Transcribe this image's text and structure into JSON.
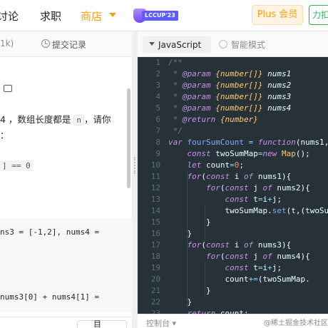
{
  "nav": {
    "item_discuss": "讨论",
    "item_jobs": "求职",
    "item_store": "商店",
    "badge": "LCCUP'23",
    "plus": "Plus 会员",
    "force": "力扣"
  },
  "problem": {
    "tab_k": "1k)",
    "tab_submissions": "提交记录",
    "desc_line1_a": "4 ，数组长度都是 ",
    "desc_chip": "n",
    "desc_line1_b": "，请你",
    "desc_line2": "：",
    "condition": "] == 0",
    "example_line1": "ns3 = [-1,2], nums4 =",
    "example_line2": "",
    "example_line3": " nums3[0] + nums4[1] =",
    "bottom_btn": "目"
  },
  "editor": {
    "language": "JavaScript",
    "smart_mode": "智能模式",
    "lines": [
      {
        "n": "1",
        "t": "/**"
      },
      {
        "n": "2",
        "t": " * @param {number[]} nums1"
      },
      {
        "n": "3",
        "t": " * @param {number[]} nums2"
      },
      {
        "n": "4",
        "t": " * @param {number[]} nums3"
      },
      {
        "n": "5",
        "t": " * @param {number[]} nums4"
      },
      {
        "n": "6",
        "t": " * @return {number}"
      },
      {
        "n": "7",
        "t": " */"
      },
      {
        "n": "8",
        "t": "var fourSumCount = function(nums1,"
      },
      {
        "n": "9",
        "t": "    const twoSumMap=new Map();"
      },
      {
        "n": "10",
        "t": "    let count=0;"
      },
      {
        "n": "11",
        "t": "    for(const i of nums1){"
      },
      {
        "n": "12",
        "t": "        for(const j of nums2){"
      },
      {
        "n": "13",
        "t": "            const t=i+j;"
      },
      {
        "n": "14",
        "t": "            twoSumMap.set(t,(twoSum"
      },
      {
        "n": "15",
        "t": "        }"
      },
      {
        "n": "16",
        "t": "    }"
      },
      {
        "n": "17",
        "t": "    for(const i of nums3){"
      },
      {
        "n": "18",
        "t": "        for(const j of nums4){"
      },
      {
        "n": "19",
        "t": "            const t=i+j;"
      },
      {
        "n": "20",
        "t": "            count+=(twoSumMap."
      },
      {
        "n": "21",
        "t": "        }"
      },
      {
        "n": "22",
        "t": "    }"
      },
      {
        "n": "23",
        "t": "    return count;"
      }
    ],
    "bottom_text": "控制台 ▾"
  },
  "watermark": "@稀土掘金技术社区",
  "colors": {
    "accent": "#ffa116",
    "editor_bg": "#263238",
    "keyword": "#c792ea",
    "type": "#ffcb6b",
    "function": "#82aaff",
    "number": "#f78c6c"
  }
}
